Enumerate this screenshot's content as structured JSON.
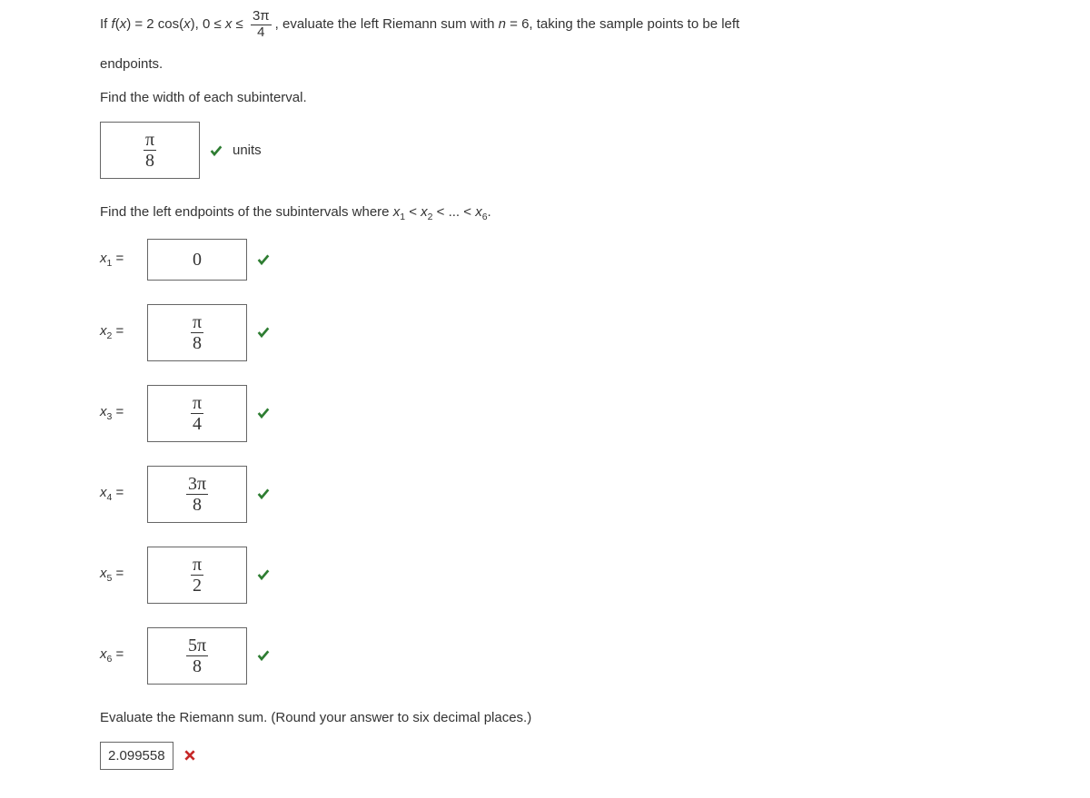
{
  "q": {
    "line1_a": "If  ",
    "fx": "f",
    "x": "x",
    "eq1": "(",
    "eq2": ") = 2 cos(",
    "eq3": "),    0 ≤ ",
    "eq4": " ≤ ",
    "frac_top": "3π",
    "frac_bot": "4",
    "line1_b": ",  evaluate the left Riemann sum with ",
    "n": "n",
    "line1_c": " = 6, taking the sample points to be left",
    "line2": "endpoints.",
    "line3": "Find the width of each subinterval.",
    "width_num": "π",
    "width_den": "8",
    "units": "units",
    "line4_a": "Find the left endpoints of the subintervals where ",
    "x1": "x",
    "s1": "1",
    "lt1": " < ",
    "x2": "x",
    "s2": "2",
    "lt2": " < ... < ",
    "x6": "x",
    "s6": "6",
    "dot": ".",
    "endpoints": [
      {
        "label_var": "x",
        "label_sub": "1",
        "value": "0",
        "is_frac": false
      },
      {
        "label_var": "x",
        "label_sub": "2",
        "num": "π",
        "den": "8",
        "is_frac": true
      },
      {
        "label_var": "x",
        "label_sub": "3",
        "num": "π",
        "den": "4",
        "is_frac": true
      },
      {
        "label_var": "x",
        "label_sub": "4",
        "num": "3π",
        "den": "8",
        "is_frac": true
      },
      {
        "label_var": "x",
        "label_sub": "5",
        "num": "π",
        "den": "2",
        "is_frac": true
      },
      {
        "label_var": "x",
        "label_sub": "6",
        "num": "5π",
        "den": "8",
        "is_frac": true
      }
    ],
    "line5": "Evaluate the Riemann sum. (Round your answer to six decimal places.)",
    "final_answer": "2.099558"
  }
}
